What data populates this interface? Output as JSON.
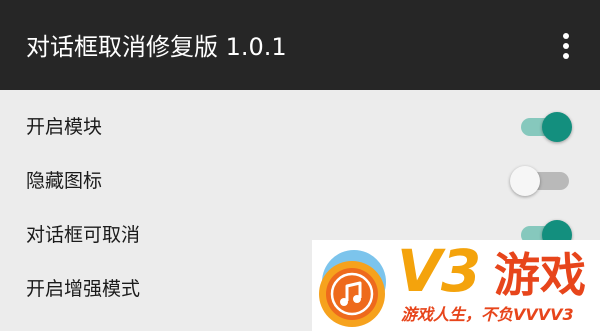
{
  "app_bar": {
    "title": "对话框取消修复版 1.0.1",
    "overflow_icon": "more-vert-icon"
  },
  "settings": [
    {
      "label": "开启模块",
      "enabled": true
    },
    {
      "label": "隐藏图标",
      "enabled": false
    },
    {
      "label": "对话框可取消",
      "enabled": true
    },
    {
      "label": "开启增强模式",
      "enabled": true
    }
  ],
  "watermark": {
    "logo_text": "V3",
    "brand_text": "游戏",
    "slogan": "游戏人生，不负VVVV3"
  },
  "colors": {
    "app_bar": "#262626",
    "background": "#ececec",
    "switch_on_thumb": "#138f7e",
    "switch_on_track": "#86c8bd",
    "switch_off_thumb": "#f6f6f6",
    "switch_off_track": "#b9b9b9",
    "watermark_orange": "#f4a30c",
    "watermark_red": "#e7451b"
  }
}
